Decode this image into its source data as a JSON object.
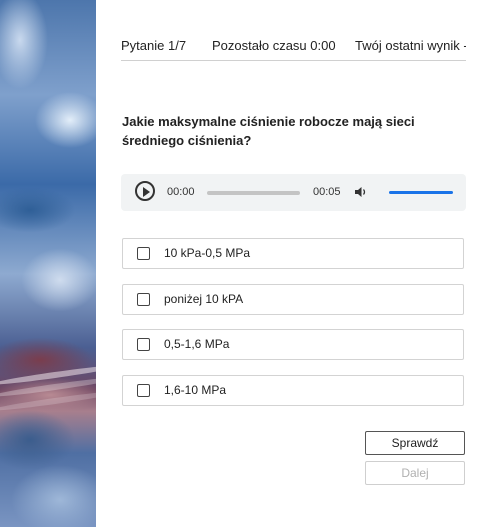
{
  "header": {
    "question_counter": "Pytanie 1/7",
    "time_left": "Pozostało czasu 0:00",
    "last_score": "Twój ostatni wynik -"
  },
  "question": {
    "text": "Jakie maksymalne ciśnienie robocze mają sieci średniego ciśnienia?"
  },
  "audio_player": {
    "current_time": "00:00",
    "duration": "00:05",
    "progress": 0.0,
    "volume": 1.0,
    "accent_color": "#1a73e8"
  },
  "options": [
    {
      "label": "10 kPa-0,5 MPa",
      "checked": false
    },
    {
      "label": "poniżej 10 kPA",
      "checked": false
    },
    {
      "label": "0,5-1,6 MPa",
      "checked": false
    },
    {
      "label": "1,6-10 MPa",
      "checked": false
    }
  ],
  "buttons": {
    "check_label": "Sprawdź",
    "next_label": "Dalej",
    "next_enabled": false
  }
}
